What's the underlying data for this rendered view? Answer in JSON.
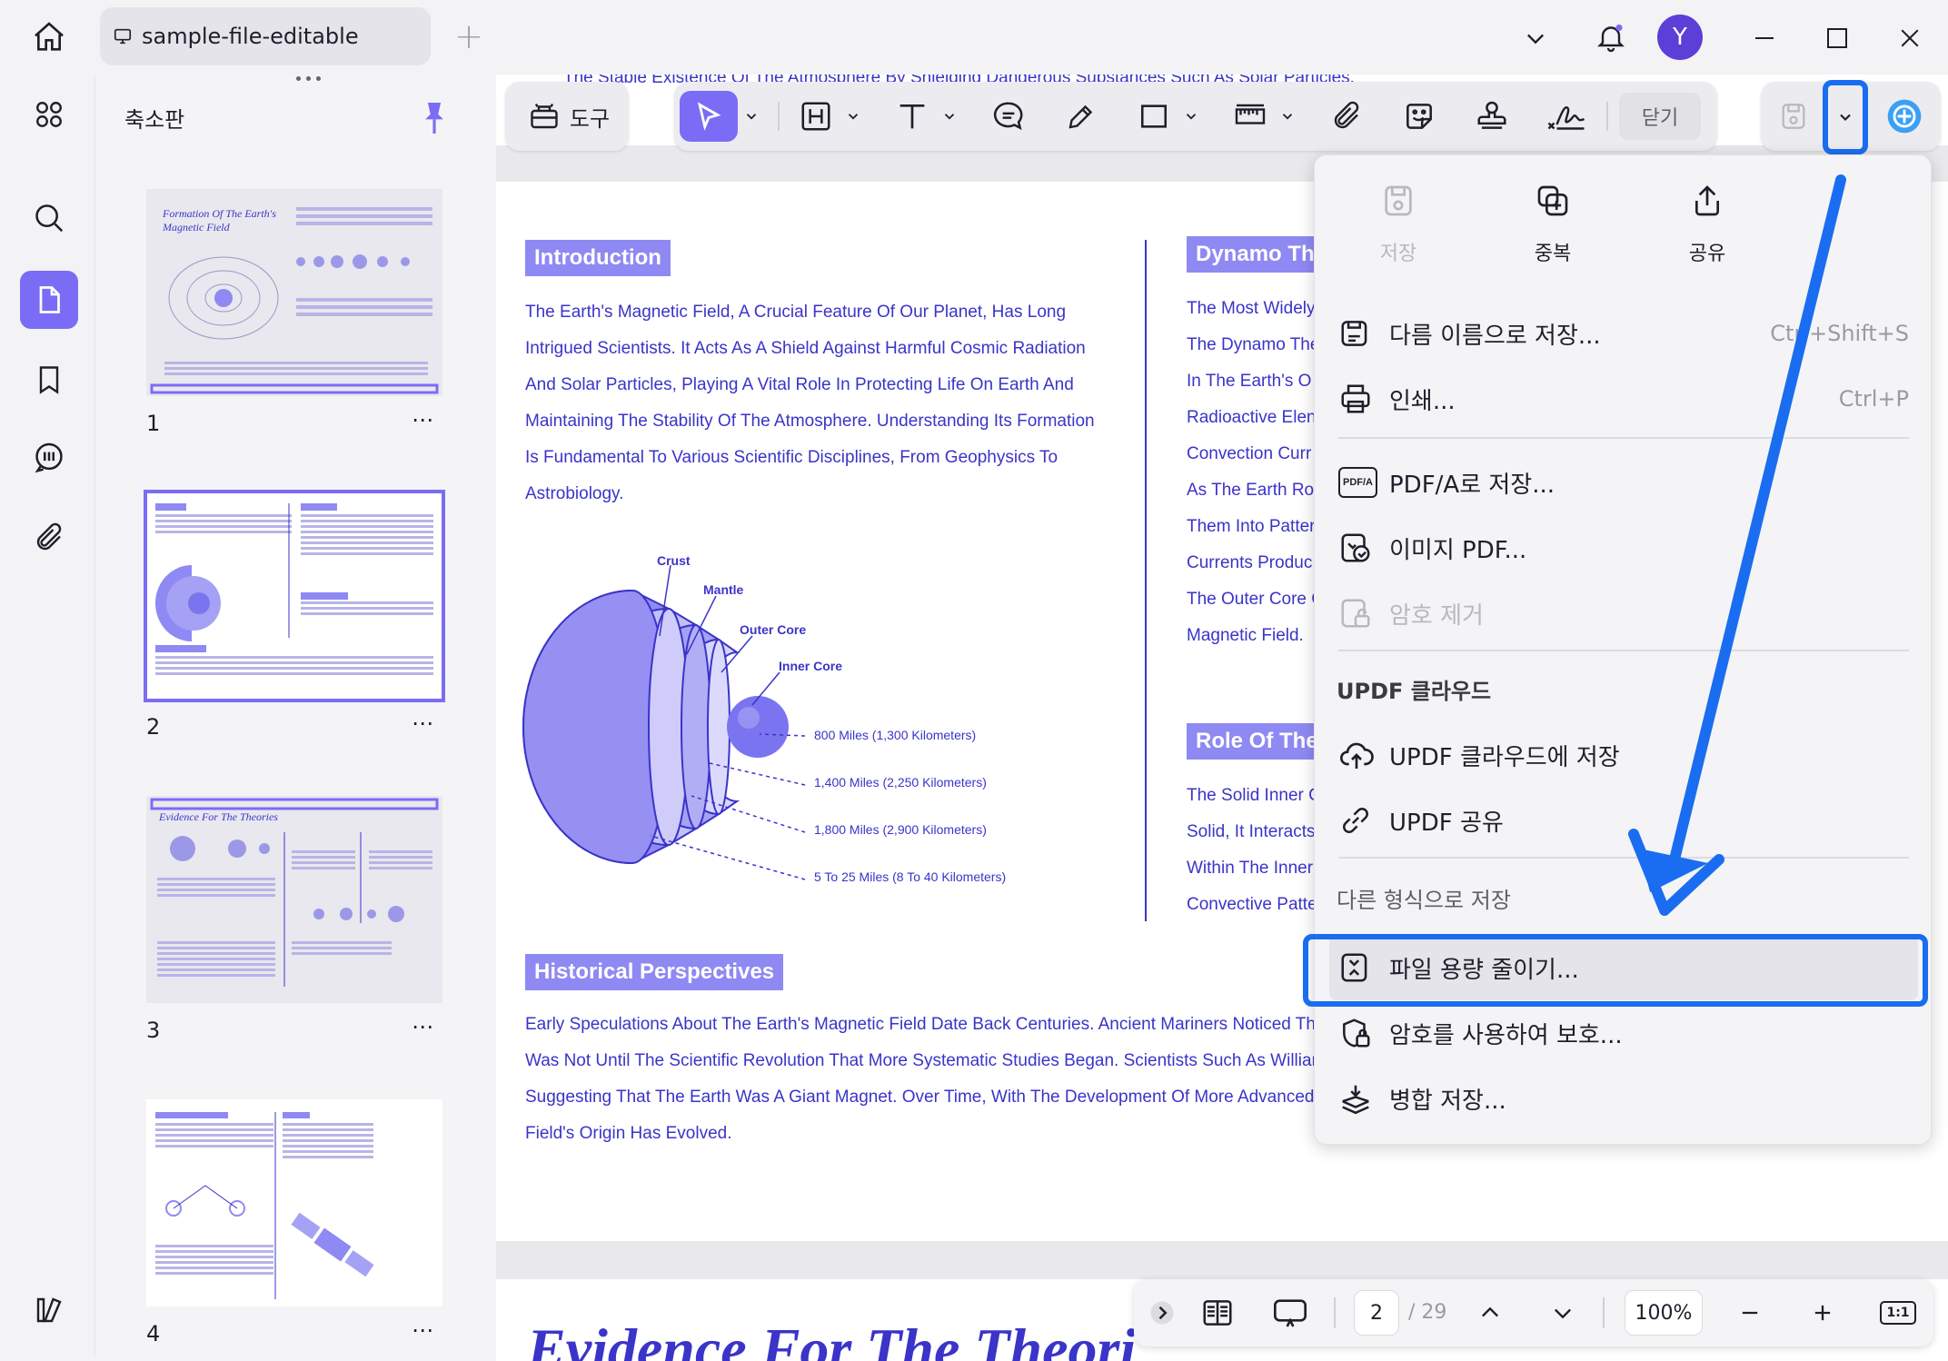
{
  "tab": {
    "title": "sample-file-editable"
  },
  "user": {
    "initial": "Y"
  },
  "thumbnails": {
    "panel_title": "축소판",
    "pages": [
      {
        "number": "1",
        "more": "⋯",
        "heading": "Formation Of The Earth's Magnetic Field"
      },
      {
        "number": "2",
        "more": "⋯"
      },
      {
        "number": "3",
        "more": "⋯",
        "heading": "Evidence For The Theories"
      },
      {
        "number": "4",
        "more": "⋯"
      }
    ]
  },
  "toolbar": {
    "tools_label": "도구",
    "close_label": "닫기"
  },
  "document": {
    "top_clip": "The Stable Existence Of The Atmosphere By Shielding Dangerous Substances Such As Solar Particles.",
    "intro_heading": "Introduction",
    "intro_lines": [
      "The Earth's Magnetic Field, A Crucial Feature Of Our Planet, Has Long",
      "Intrigued Scientists. It Acts As A Shield Against Harmful Cosmic Radiation",
      "And Solar Particles, Playing A Vital Role In Protecting Life On Earth And",
      "Maintaining The Stability Of The Atmosphere. Understanding Its Formation",
      "Is Fundamental To Various Scientific Disciplines, From Geophysics To",
      "Astrobiology."
    ],
    "dynamo_heading": "Dynamo Th",
    "dynamo_lines": [
      "The Most Widely",
      "The Dynamo The",
      "In The Earth's O",
      "Radioactive Elen",
      "Convection Curr",
      "As The Earth Ro",
      "Them Into Patter",
      "Currents Produc",
      "The Outer Core C",
      "Magnetic Field."
    ],
    "role_heading": "Role Of The",
    "role_lines": [
      "The Solid Inner C",
      "Solid, It Interacts",
      "Within The Inner",
      "Convective Patte"
    ],
    "diagram_labels": {
      "crust": "Crust",
      "mantle": "Mantle",
      "outer_core": "Outer Core",
      "inner_core": "Inner Core",
      "d1": "800 Miles (1,300 Kilometers)",
      "d2": "1,400 Miles (2,250 Kilometers)",
      "d3": "1,800 Miles (2,900 Kilometers)",
      "d4": "5 To 25 Miles (8 To 40 Kilometers)"
    },
    "hist_heading": "Historical Perspectives",
    "hist_lines": [
      "Early Speculations About The Earth's Magnetic Field Date Back Centuries. Ancient Mariners Noticed The",
      "Was Not Until The Scientific Revolution That More Systematic Studies Began. Scientists Such As William",
      "Suggesting That The Earth Was A Giant Magnet. Over Time, With The Development Of More Advanced",
      "Field's Origin Has Evolved."
    ],
    "next_page_heading": "Evidence For The Theori"
  },
  "menu": {
    "top_actions": [
      {
        "label": "저장",
        "disabled": true
      },
      {
        "label": "중복",
        "disabled": false
      },
      {
        "label": "공유",
        "disabled": false
      }
    ],
    "save_as": {
      "label": "다름 이름으로 저장...",
      "shortcut": "Ctrl+Shift+S"
    },
    "print": {
      "label": "인쇄...",
      "shortcut": "Ctrl+P"
    },
    "save_pdfa": "PDF/A로 저장...",
    "image_pdf": "이미지 PDF...",
    "remove_password": "암호 제거",
    "cloud_section": "UPDF 클라우드",
    "save_cloud": "UPDF 클라우드에 저장",
    "share_updf": "UPDF 공유",
    "other_section": "다른 형식으로 저장",
    "reduce_size": "파일 용량 줄이기...",
    "protect": "암호를 사용하여 보호...",
    "flatten": "병합 저장...",
    "pdfa_icon_text": "PDF/A"
  },
  "bottombar": {
    "current_page": "2",
    "total_pages": "/ 29",
    "zoom": "100%",
    "fit_label": "1:1"
  },
  "colors": {
    "accent": "#7b6cf6",
    "highlight": "#1a6df0",
    "doc_text": "#3a34c9"
  }
}
